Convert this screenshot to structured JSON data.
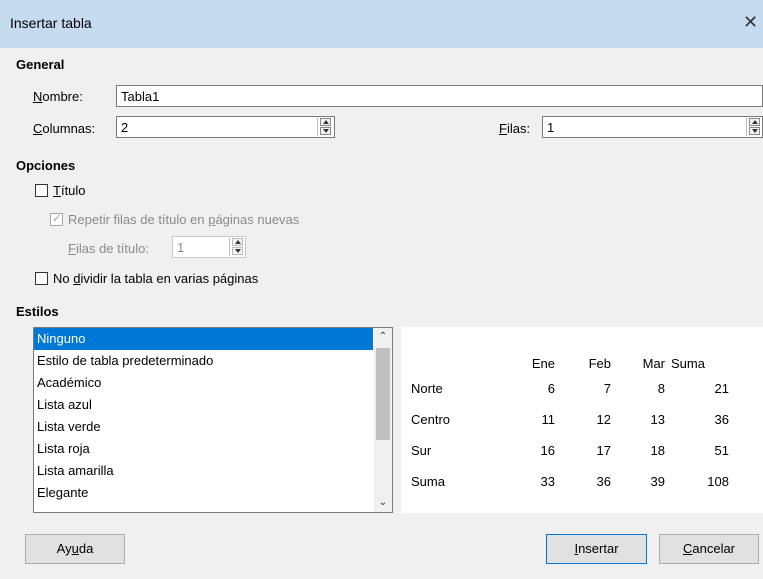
{
  "window": {
    "title": "Insertar tabla",
    "close_icon": "close-icon"
  },
  "general": {
    "section_label": "General",
    "name_label": "Nombre:",
    "name_value": "Tabla1",
    "columns_label": "Columnas:",
    "columns_value": "2",
    "rows_label": "Filas:",
    "rows_value": "1"
  },
  "options": {
    "section_label": "Opciones",
    "title_label": "Título",
    "title_checked": false,
    "repeat_label": "Repetir filas de título en páginas nuevas",
    "repeat_checked": true,
    "header_rows_label": "Filas de título:",
    "header_rows_value": "1",
    "nosplit_label": "No dividir la tabla en varias páginas",
    "nosplit_checked": false
  },
  "styles": {
    "section_label": "Estilos",
    "items": [
      "Ninguno",
      "Estilo de tabla predeterminado",
      "Académico",
      "Lista azul",
      "Lista verde",
      "Lista roja",
      "Lista amarilla",
      "Elegante"
    ],
    "selected": "Ninguno"
  },
  "preview": {
    "header": [
      "",
      "Ene",
      "Feb",
      "Mar",
      "Suma"
    ],
    "rows": [
      [
        "Norte",
        "6",
        "7",
        "8",
        "21"
      ],
      [
        "Centro",
        "11",
        "12",
        "13",
        "36"
      ],
      [
        "Sur",
        "16",
        "17",
        "18",
        "51"
      ],
      [
        "Suma",
        "33",
        "36",
        "39",
        "108"
      ]
    ]
  },
  "buttons": {
    "help": "Ayuda",
    "insert": "Insertar",
    "cancel": "Cancelar"
  },
  "colors": {
    "titlebar": "#c7dbf0",
    "selection": "#0078d7",
    "dialog_bg": "#f0f0f0"
  }
}
